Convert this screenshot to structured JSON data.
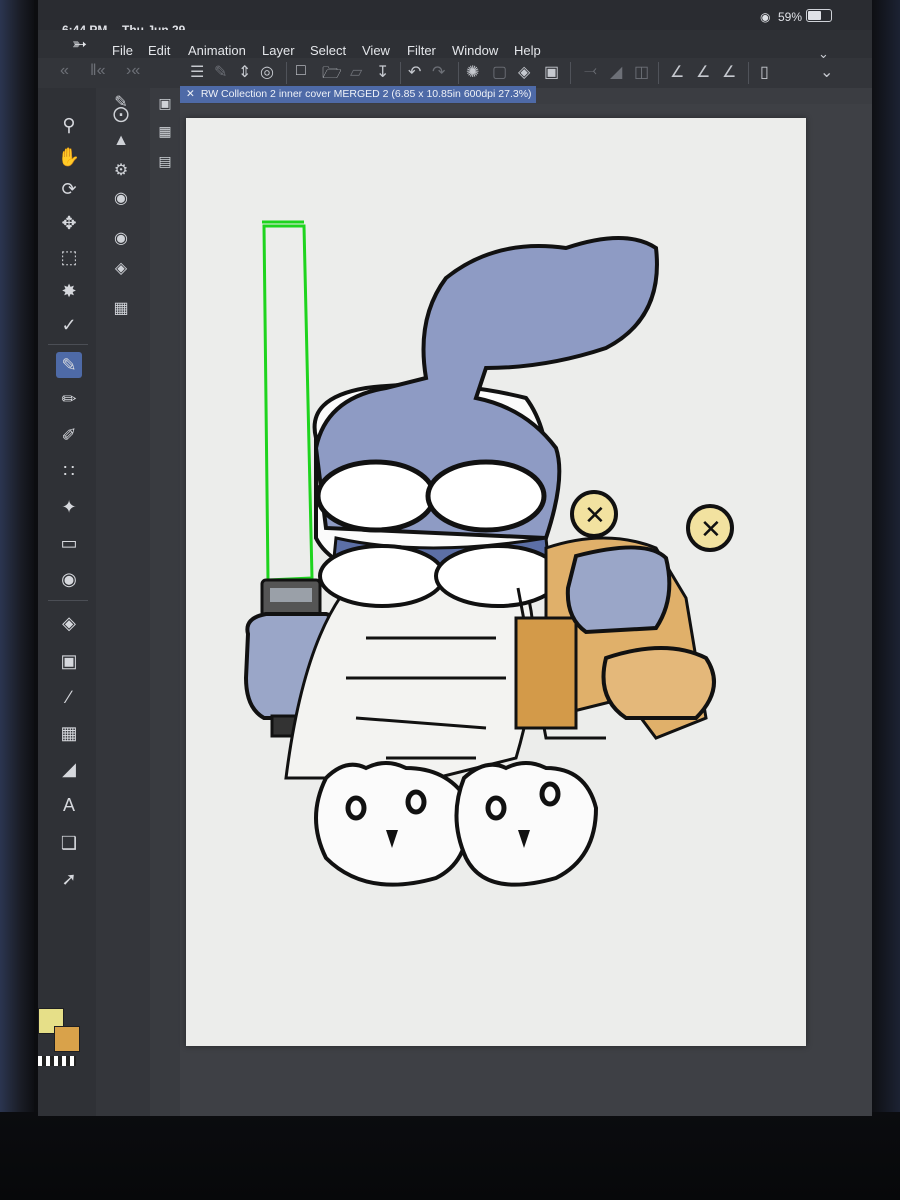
{
  "status_bar": {
    "time": "6:44 PM",
    "date": "Thu Jun 29",
    "battery": "59%"
  },
  "menu": [
    "File",
    "Edit",
    "Animation",
    "Layer",
    "Select",
    "View",
    "Filter",
    "Window",
    "Help"
  ],
  "document_tab": {
    "title": "RW Collection 2 inner cover MERGED 2 (6.85 x 10.85in 600dpi 27.3%)"
  },
  "colors": {
    "main": "#e6df88",
    "sub": "#d9a24a",
    "accent": "#4e6aa7"
  },
  "tools": [
    "search-icon",
    "hand-icon",
    "rotate-icon",
    "move-icon",
    "selection-icon",
    "magic-wand-icon",
    "eyedropper-icon",
    "pen-icon",
    "pencil-icon",
    "brush-icon",
    "airbrush-icon",
    "decoration-icon",
    "eraser-icon",
    "blend-icon",
    "fill-icon",
    "gradient-icon",
    "line-icon",
    "frame-icon",
    "ruler-icon",
    "text-icon",
    "balloon-icon",
    "correct-line-icon"
  ]
}
